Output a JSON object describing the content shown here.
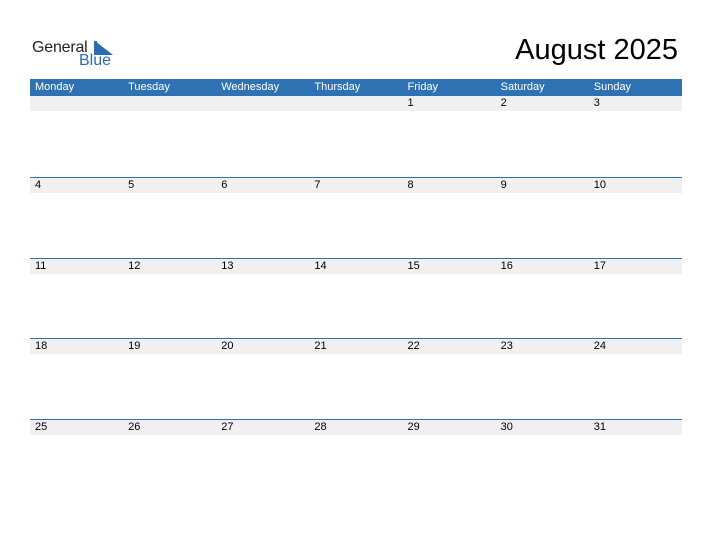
{
  "logo": {
    "line1": "General",
    "line2": "Blue",
    "accent": "#2b6cb0"
  },
  "title": "August 2025",
  "weekdays": [
    "Monday",
    "Tuesday",
    "Wednesday",
    "Thursday",
    "Friday",
    "Saturday",
    "Sunday"
  ],
  "weeks": [
    [
      "",
      "",
      "",
      "",
      "1",
      "2",
      "3"
    ],
    [
      "4",
      "5",
      "6",
      "7",
      "8",
      "9",
      "10"
    ],
    [
      "11",
      "12",
      "13",
      "14",
      "15",
      "16",
      "17"
    ],
    [
      "18",
      "19",
      "20",
      "21",
      "22",
      "23",
      "24"
    ],
    [
      "25",
      "26",
      "27",
      "28",
      "29",
      "30",
      "31"
    ]
  ],
  "colors": {
    "header": "#2f72b3",
    "row_band": "#f0f0f0"
  }
}
